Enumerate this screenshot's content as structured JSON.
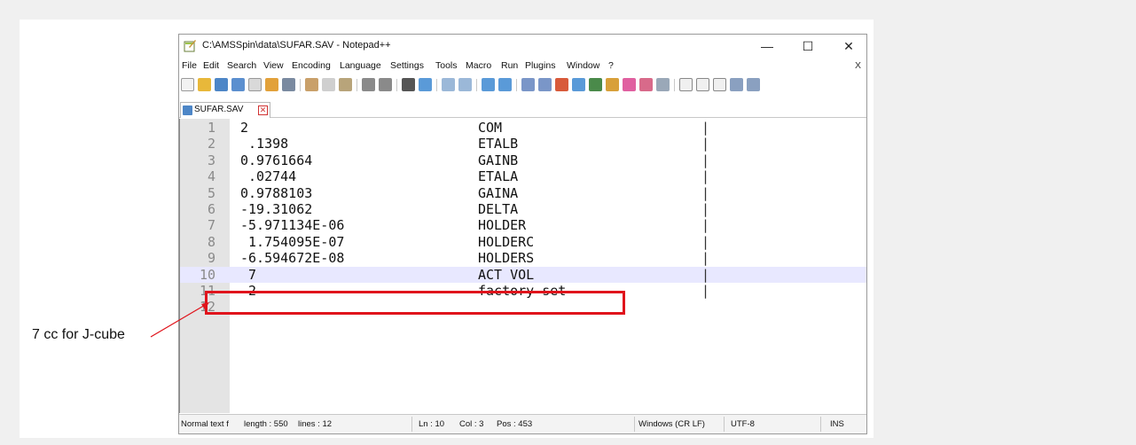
{
  "window": {
    "title": "C:\\AMSSpin\\data\\SUFAR.SAV - Notepad++",
    "minimize": "—",
    "maximize": "☐",
    "close": "✕"
  },
  "menu": {
    "items": [
      "File",
      "Edit",
      "Search",
      "View",
      "Encoding",
      "Language",
      "Settings",
      "Tools",
      "Macro",
      "Run",
      "Plugins",
      "Window",
      "?"
    ],
    "close_label": "X"
  },
  "tab": {
    "label": "SUFAR.SAV",
    "close": "✕"
  },
  "editor": {
    "current_line": 10,
    "lines": [
      {
        "num": "1",
        "value": "2",
        "name": "COM",
        "bar": "|"
      },
      {
        "num": "2",
        "value": " .1398",
        "name": "ETALB",
        "bar": "|"
      },
      {
        "num": "3",
        "value": "0.9761664",
        "name": "GAINB",
        "bar": "|"
      },
      {
        "num": "4",
        "value": " .02744",
        "name": "ETALA",
        "bar": "|"
      },
      {
        "num": "5",
        "value": "0.9788103",
        "name": "GAINA",
        "bar": "|"
      },
      {
        "num": "6",
        "value": "-19.31062",
        "name": "DELTA",
        "bar": "|"
      },
      {
        "num": "7",
        "value": "-5.971134E-06",
        "name": "HOLDER",
        "bar": "|"
      },
      {
        "num": "8",
        "value": " 1.754095E-07",
        "name": "HOLDERC",
        "bar": "|"
      },
      {
        "num": "9",
        "value": "-6.594672E-08",
        "name": "HOLDERS",
        "bar": "|"
      },
      {
        "num": "10",
        "value": " 7",
        "name": "ACT VOL",
        "bar": "|"
      },
      {
        "num": "11",
        "value": " 2",
        "name": "factory set",
        "bar": "|"
      },
      {
        "num": "12",
        "value": "",
        "name": "",
        "bar": ""
      }
    ]
  },
  "status": {
    "type": "Normal text f",
    "length": "length : 550",
    "lines": "lines : 12",
    "ln": "Ln : 10",
    "col": "Col : 3",
    "pos": "Pos : 453",
    "eol": "Windows (CR LF)",
    "encoding": "UTF-8",
    "mode": "INS"
  },
  "annotation": {
    "text": "7 cc for J-cube",
    "color": "#e0141c"
  },
  "colors": {
    "current_line": "#e8e8ff",
    "gutter": "#e4e4e4"
  }
}
